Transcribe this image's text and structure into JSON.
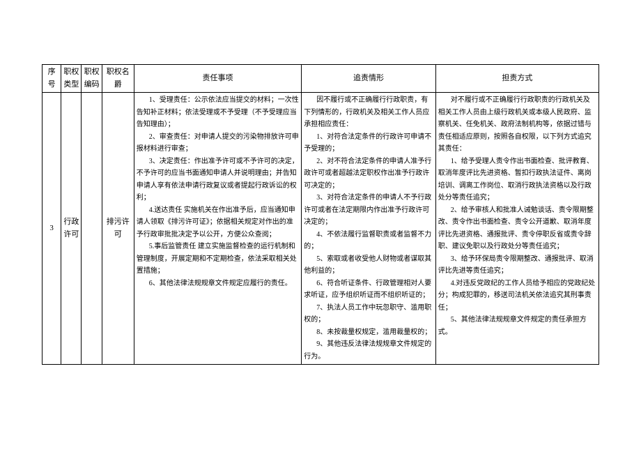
{
  "headers": {
    "seq": "序号",
    "type": "职权类型",
    "code": "职权编码",
    "name": "职权名爵",
    "resp": "责任事项",
    "acc": "追责情形",
    "method": "担责方式"
  },
  "row": {
    "seq": "3",
    "type": "行政许可",
    "code": "",
    "name": "排污许可",
    "resp": {
      "p1": "1、受理责任：公示依法应当提交的材料；一次性告知补正材料；依法受理或不予受理（不予受理应当告知理由）；",
      "p2": "2、审查责任：对申请人提交的污染物排放许可申报材料进行审查；",
      "p3": "3、决定责任：作出准予许可或不予许可的决定，不予许可的应当书面通知申请人并说明理由；并告知申请人享有依法申请行政复议或者提起行政诉讼的权利；",
      "p4": "4.送达责任 实施机关在作出准予后，应当通知申请人领取《排污许可证》；依据相关规定对作出的准予行政审批批决定予以公开，方便公众查阅；",
      "p5": "5.事后监管责任 建立实施监督检查的运行机制和管理制度，开展定期和不定期检查，依法采取相关处置措施；",
      "p6": "6、其他法律法规规章文件规定应履行的责任。"
    },
    "acc": {
      "intro": "因不履行或不正确履行行政职责，有下列情形的，行政机关及相关工作人员应承担相应责任：",
      "p1": "1、对符合法定条件的行政许可申请不予受理的；",
      "p2": "2、对不符合法定条件的申请人准予行政许可或者超越法定职权作出准予行政许可决定的；",
      "p3": "3、对符合法定条件的申请人不予行政许可或者在法定期限内作出准予行政许可决定的；",
      "p4": "4、不依法履行监督职责或者监督不力的；",
      "p5": "5、索取或者收受他人财物或者谋取其他利益的；",
      "p6": "6、符合听证条件、行政管理相对人要求听证，应予组织听证而不组织听证的；",
      "p7": "7、执法人员工作中玩忽职守、滥用职权的；",
      "p8": "8、未按裁量权规定，滥用裁量权的；",
      "p9": "9、其他违反法律法规规章文件规定的行为。"
    },
    "method": {
      "intro": "对不履行或不正确履行行政职责的行政机关及相关工作人员由上级行政机关或本级人民政府、监察机关、任免机关、政府法制机构等，依据过错与责任相适应原则，按照各自权限，以下列方式追究其责任：",
      "p1": "1、给予受理人责令作出书面检查、批评教育、取消年度评比先进资格、暂扣行政执法证件、离岗培训、调离工作岗位、取消行政执法资格以及行政处分等责任追究；",
      "p2": "2、给予审核人和批准人诫勉谈话、责令限期整改、责令作出书面检查、责令公开道歉、取消年度评比先进资格、通报批评、责令停职反省或责令辞职、建议免职以及行政处分等责任追究；",
      "p3": "3、给予环保局责令限期整改、通报批评、取消评比先进等责任追究；",
      "p4": "4.对违反党政纪的工作人员给予相应的党政纪处分；构成犯罪的，移送司法机关依法追究其刑事责任；",
      "p5": "5、其他法律法规规章文件规定的责任承担方式。"
    }
  }
}
